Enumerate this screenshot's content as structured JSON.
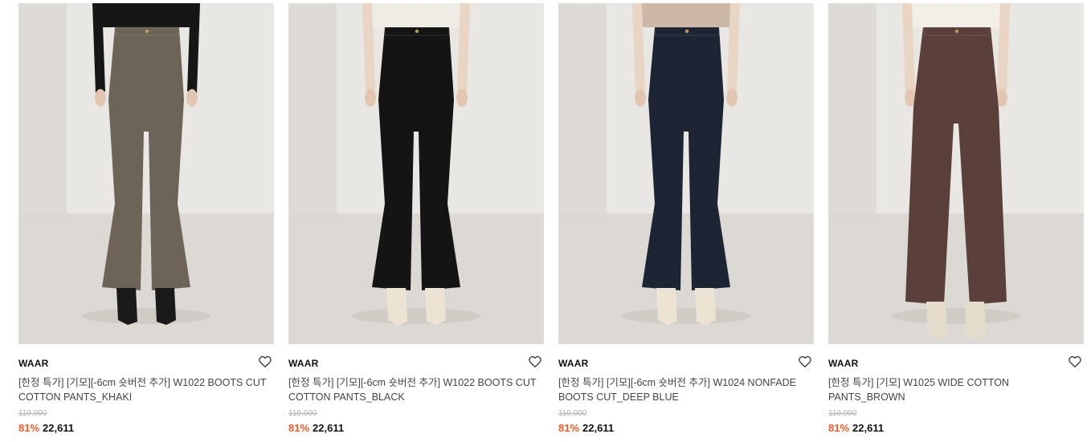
{
  "colors": {
    "discount": "#f05a28",
    "strike": "#b0b0b0"
  },
  "products": [
    {
      "brand": "WAAR",
      "title": "[한정 특가] [기모][-6cm 숏버전 추가] W1022 BOOTS CUT COTTON PANTS_KHAKI",
      "original_price": "119,000",
      "discount": "81%",
      "price": "22,611",
      "pants_color": "#6e6357",
      "top_color": "#161616",
      "shoe_color": "#1a1a1a",
      "cut": "boots"
    },
    {
      "brand": "WAAR",
      "title": "[한정 특가] [기모][-6cm 숏버전 추가] W1022 BOOTS CUT COTTON PANTS_BLACK",
      "original_price": "119,000",
      "discount": "81%",
      "price": "22,611",
      "pants_color": "#141414",
      "top_color": "#efece6",
      "shoe_color": "#ece3d2",
      "cut": "boots"
    },
    {
      "brand": "WAAR",
      "title": "[한정 특가] [기모][-6cm 숏버전 추가] W1024 NONFADE BOOTS CUT_DEEP BLUE",
      "original_price": "119,000",
      "discount": "81%",
      "price": "22,611",
      "pants_color": "#1d2433",
      "top_color": "#cdb7a6",
      "shoe_color": "#ece3d2",
      "cut": "boots"
    },
    {
      "brand": "WAAR",
      "title": "[한정 특가] [기모] W1025 WIDE COTTON PANTS_BROWN",
      "original_price": "119,000",
      "discount": "81%",
      "price": "22,611",
      "pants_color": "#5b3f3a",
      "top_color": "#f2efe9",
      "shoe_color": "#e6dccb",
      "cut": "wide"
    }
  ]
}
